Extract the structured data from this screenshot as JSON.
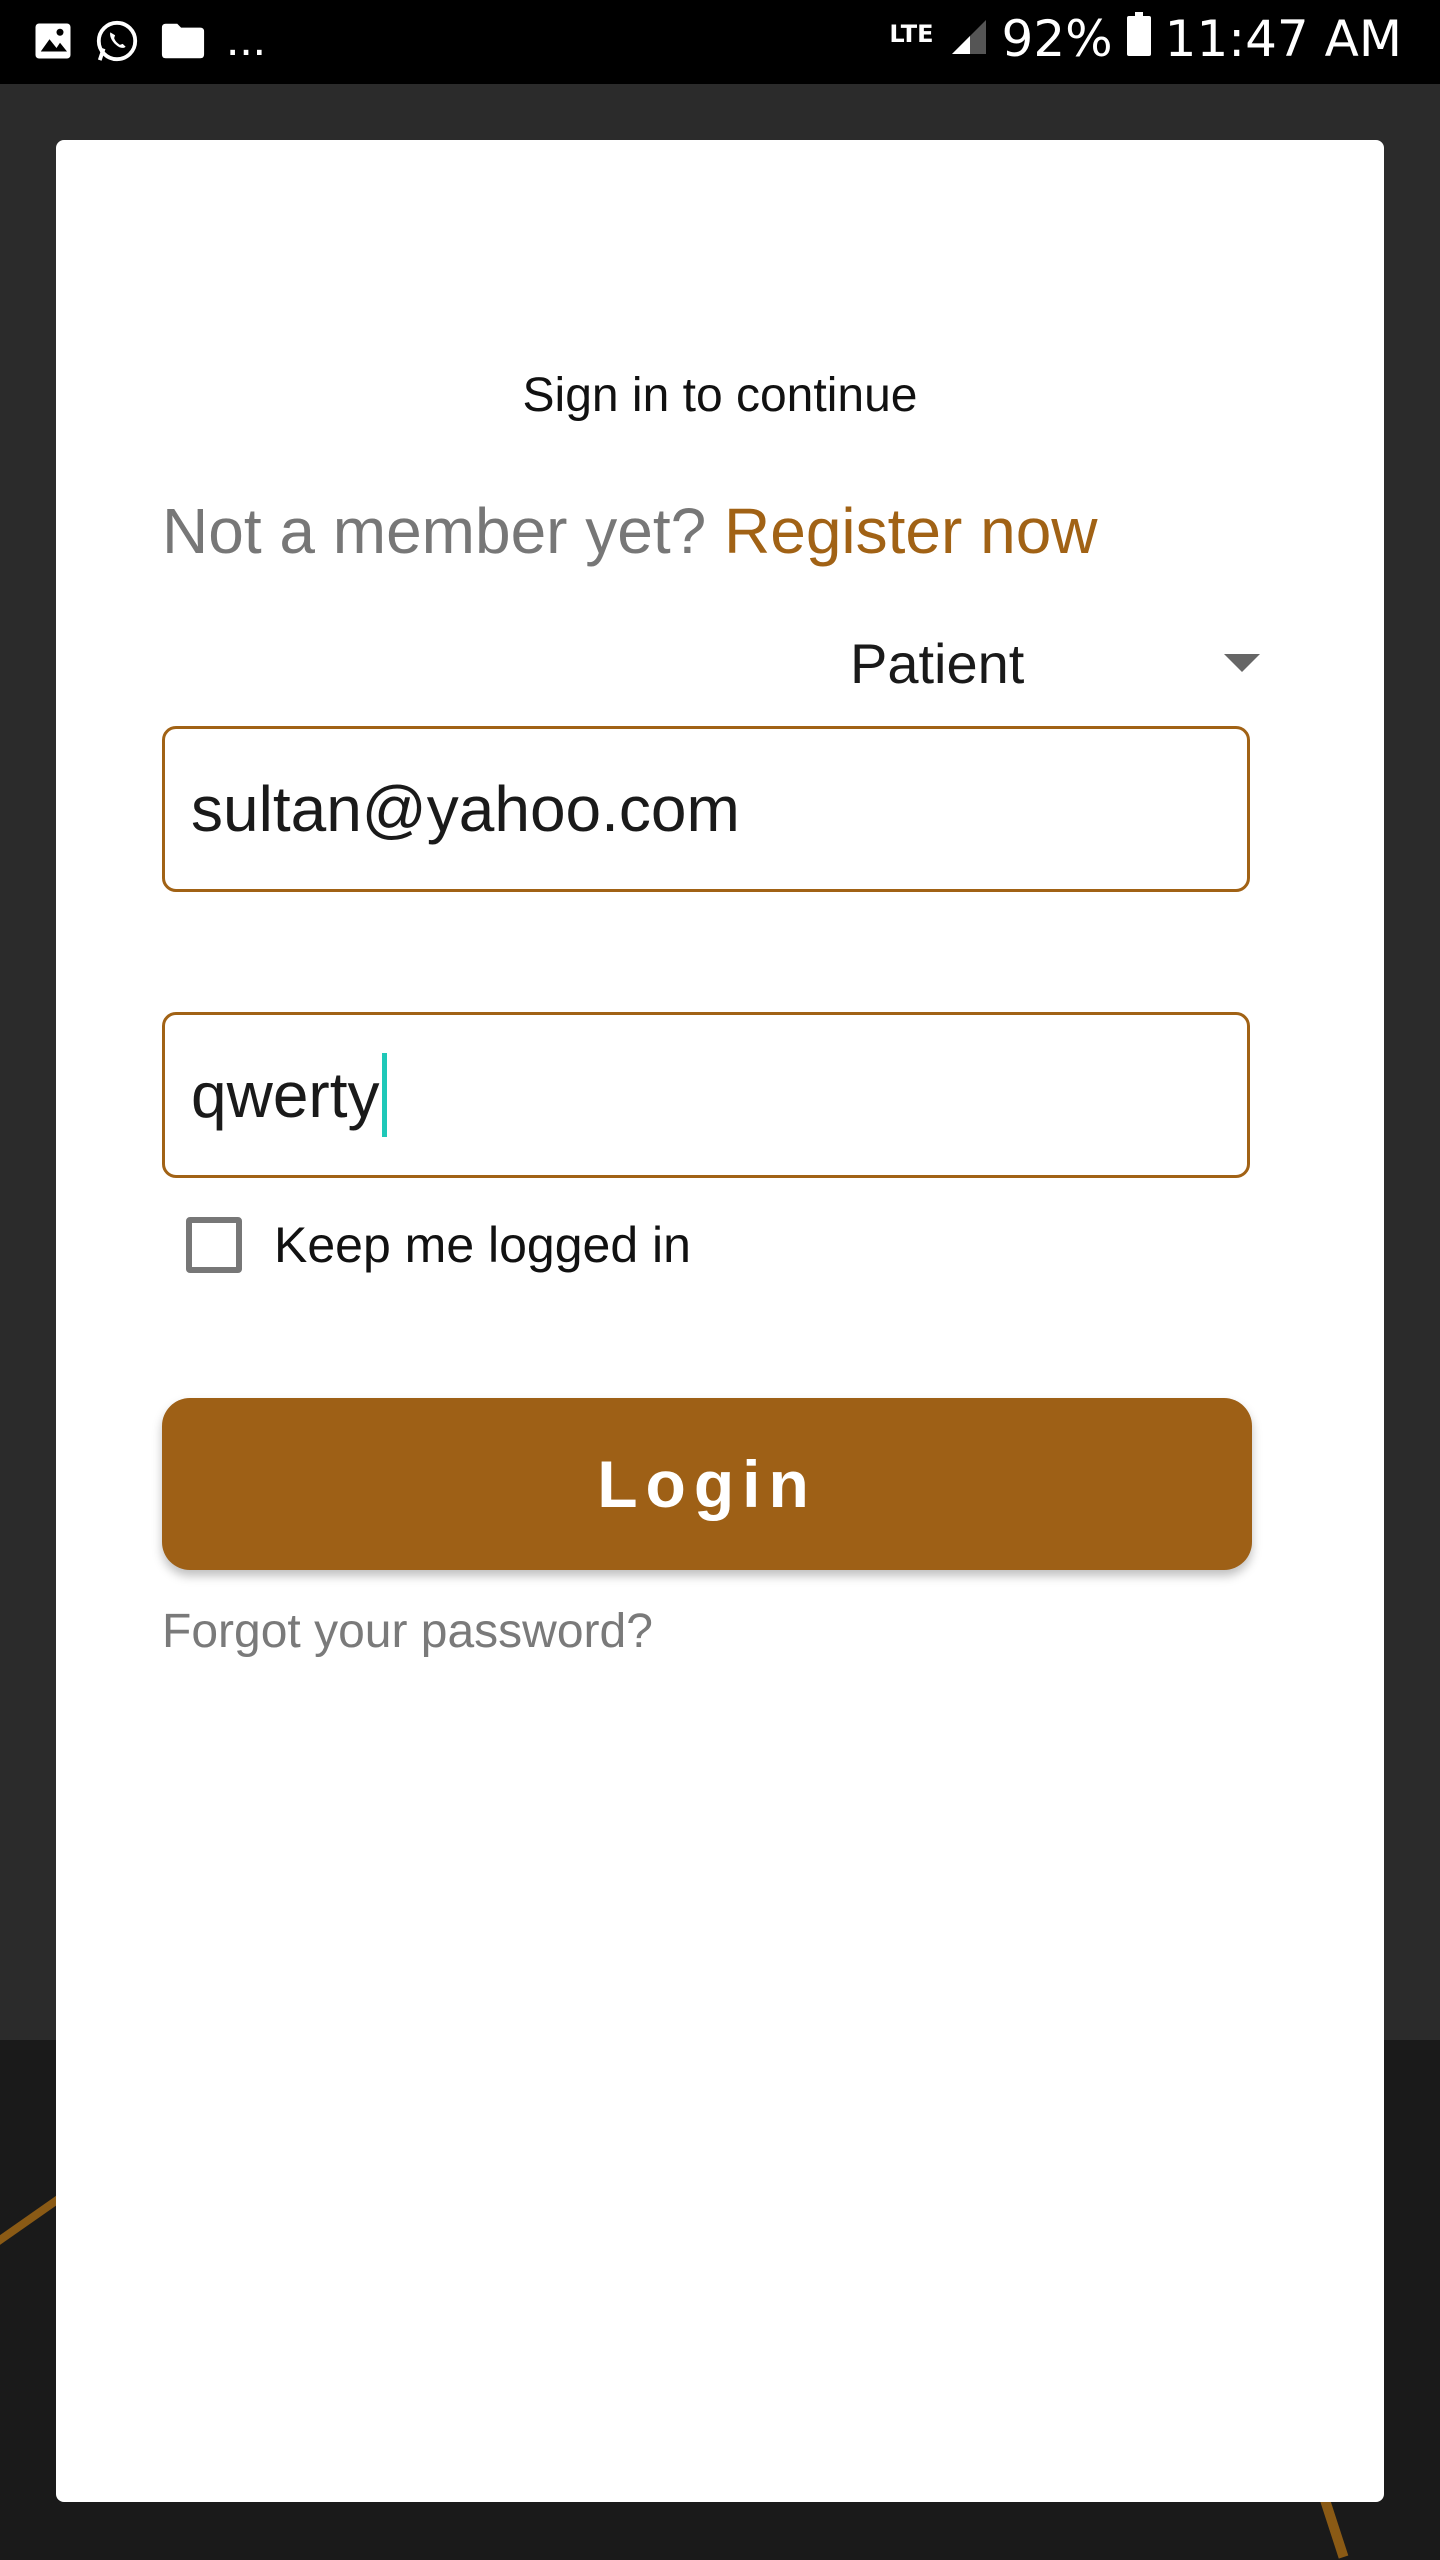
{
  "status_bar": {
    "notification_icons": [
      "image-icon",
      "whatsapp-icon",
      "folder-icon"
    ],
    "more_indicator": "...",
    "network": "LTE",
    "battery_percent": "92%",
    "time": "11:47 AM"
  },
  "dialog": {
    "title": "Sign in to continue",
    "member_prompt": "Not a member yet?",
    "register_link": "Register now",
    "role_select": {
      "value": "Patient"
    },
    "email_field": {
      "value": "sultan@yahoo.com"
    },
    "password_field": {
      "value": "qwerty"
    },
    "keep_logged_in": {
      "label": "Keep me logged in",
      "checked": false
    },
    "login_button": "Login",
    "forgot_link": "Forgot your password?"
  },
  "colors": {
    "accent": "#a16215",
    "button": "#9e6016",
    "cursor": "#1fc8b8"
  }
}
